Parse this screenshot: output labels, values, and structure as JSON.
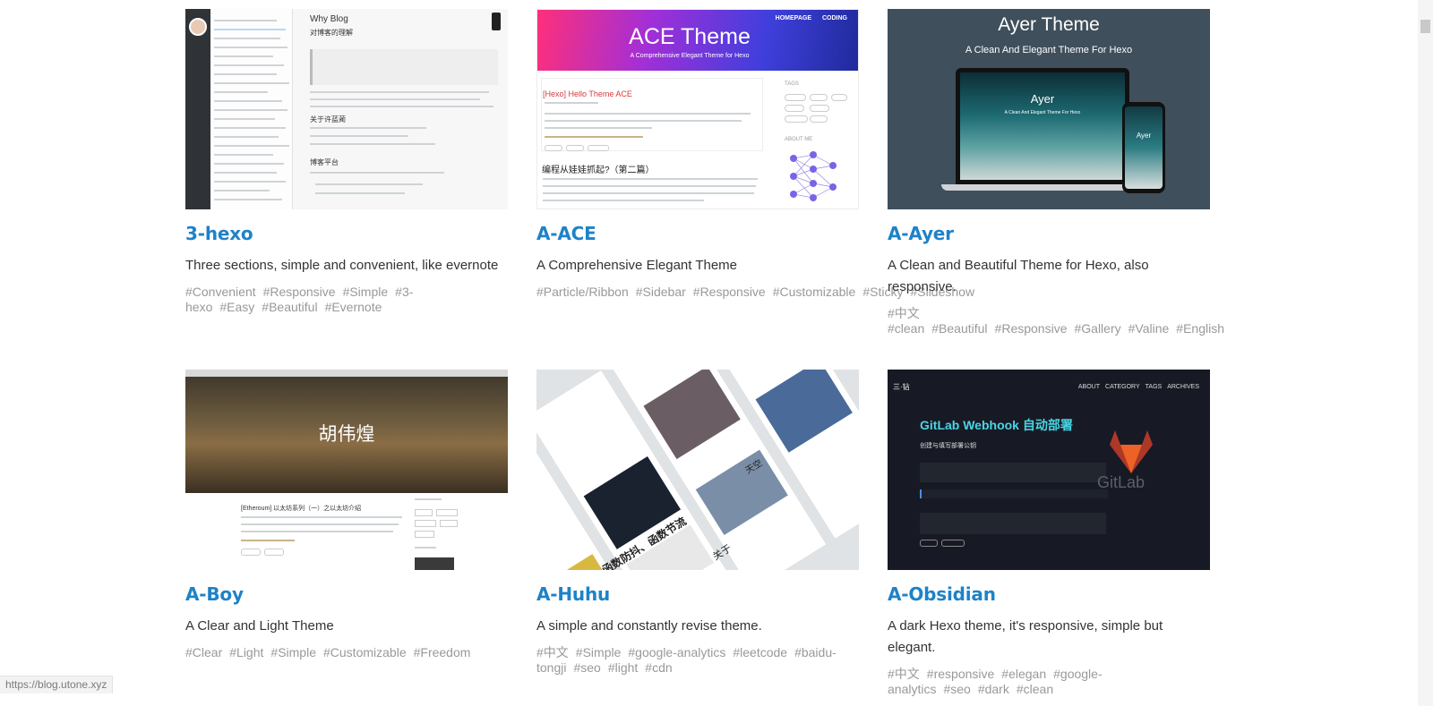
{
  "themes": [
    {
      "name": "3-hexo",
      "description": "Three sections, simple and convenient, like evernote",
      "tags": [
        "#Convenient",
        "#Responsive",
        "#Simple",
        "#3-hexo",
        "#Easy",
        "#Beautiful",
        "#Evernote"
      ],
      "preview": {
        "heading": "Why Blog",
        "subheading": "对博客的理解",
        "section1": "关于许蓝蔺",
        "section2": "博客平台"
      }
    },
    {
      "name": "A-ACE",
      "description": "A Comprehensive Elegant Theme",
      "tags": [
        "#Particle/Ribbon",
        "#Sidebar",
        "#Responsive",
        "#Customizable",
        "#Sticky",
        "#Slideshow"
      ],
      "preview": {
        "nav_home": "HOMEPAGE",
        "nav_coding": "CODING",
        "banner_title": "ACE Theme",
        "banner_sub": "A Comprehensive Elegant Theme for Hexo",
        "post_title": "[Hexo] Hello Theme ACE",
        "post2_title": "编程从娃娃抓起?（第二篇）",
        "side_tags": "TAGS",
        "side_about": "ABOUT ME"
      }
    },
    {
      "name": "A-Ayer",
      "description": "A Clean and Beautiful Theme for Hexo, also responsive.",
      "tags": [
        "#中文",
        "#clean",
        "#Beautiful",
        "#Responsive",
        "#Gallery",
        "#Valine",
        "#English"
      ],
      "preview": {
        "title": "Ayer Theme",
        "subtitle": "A Clean And Elegant Theme For Hexo",
        "screen_title": "Ayer",
        "screen_sub": "A Clean And Elegant Theme For Hexo",
        "phone_title": "Ayer"
      }
    },
    {
      "name": "A-Boy",
      "description": "A Clear and Light Theme",
      "tags": [
        "#Clear",
        "#Light",
        "#Simple",
        "#Customizable",
        "#Freedom"
      ],
      "preview": {
        "hero_text": "胡伟煌",
        "post_title": "[Etheroum] 以太坊系列（一）之以太坊介绍"
      }
    },
    {
      "name": "A-Huhu",
      "description": "A simple and constantly revise theme.",
      "tags": [
        "#中文",
        "#Simple",
        "#google-analytics",
        "#leetcode",
        "#baidu-tongji",
        "#seo",
        "#light",
        "#cdn"
      ],
      "preview": {
        "label_a": "函数防抖、函数节流",
        "label_b": "关于",
        "label_c": "天空"
      }
    },
    {
      "name": "A-Obsidian",
      "description": "A dark Hexo theme, it's responsive, simple but elegant.",
      "tags": [
        "#中文",
        "#responsive",
        "#elegan",
        "#google-analytics",
        "#seo",
        "#dark",
        "#clean"
      ],
      "preview": {
        "logo": "三·钻",
        "nav": [
          "ABOUT",
          "CATEGORY",
          "TAGS",
          "ARCHIVES"
        ],
        "post_title": "GitLab Webhook 自动部署",
        "sub1": "创建与填写部署公钥",
        "gitlab_word": "GitLab"
      }
    }
  ],
  "status_url": "https://blog.utone.xyz",
  "colors": {
    "title_link": "#1e82c8",
    "tag": "#999999",
    "text": "#333333"
  }
}
